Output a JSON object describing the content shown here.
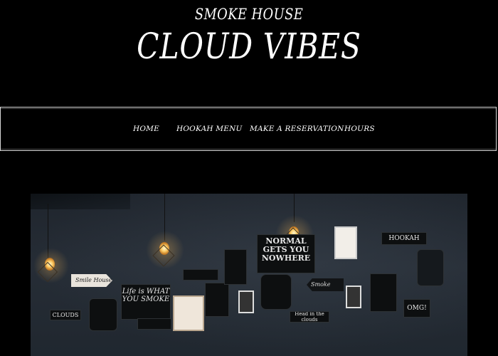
{
  "header": {
    "subtitle": "SMOKE HOUSE",
    "title": "CLOUD VIBES"
  },
  "nav": {
    "items": [
      {
        "label": "HOME"
      },
      {
        "label": "HOOKAH MENU"
      },
      {
        "label": "MAKE A RESERVATION"
      },
      {
        "label": "HOURS"
      }
    ]
  },
  "hero": {
    "signs": {
      "arrow_left_sign": "Smile House",
      "norm_sign": "NORMAL GETS YOU NOWHERE",
      "life_sign": "Life is WHAT YOU SMOKE",
      "hookah_sign": "HOOKAH",
      "clouds_sign": "CLOUDS",
      "omg_sign": "OMG!",
      "head_sign": "Head in the clouds",
      "smoke_sign": "Smoke"
    },
    "colors": {
      "wall": "#232a33",
      "bulb": "#ffcf6a"
    }
  }
}
